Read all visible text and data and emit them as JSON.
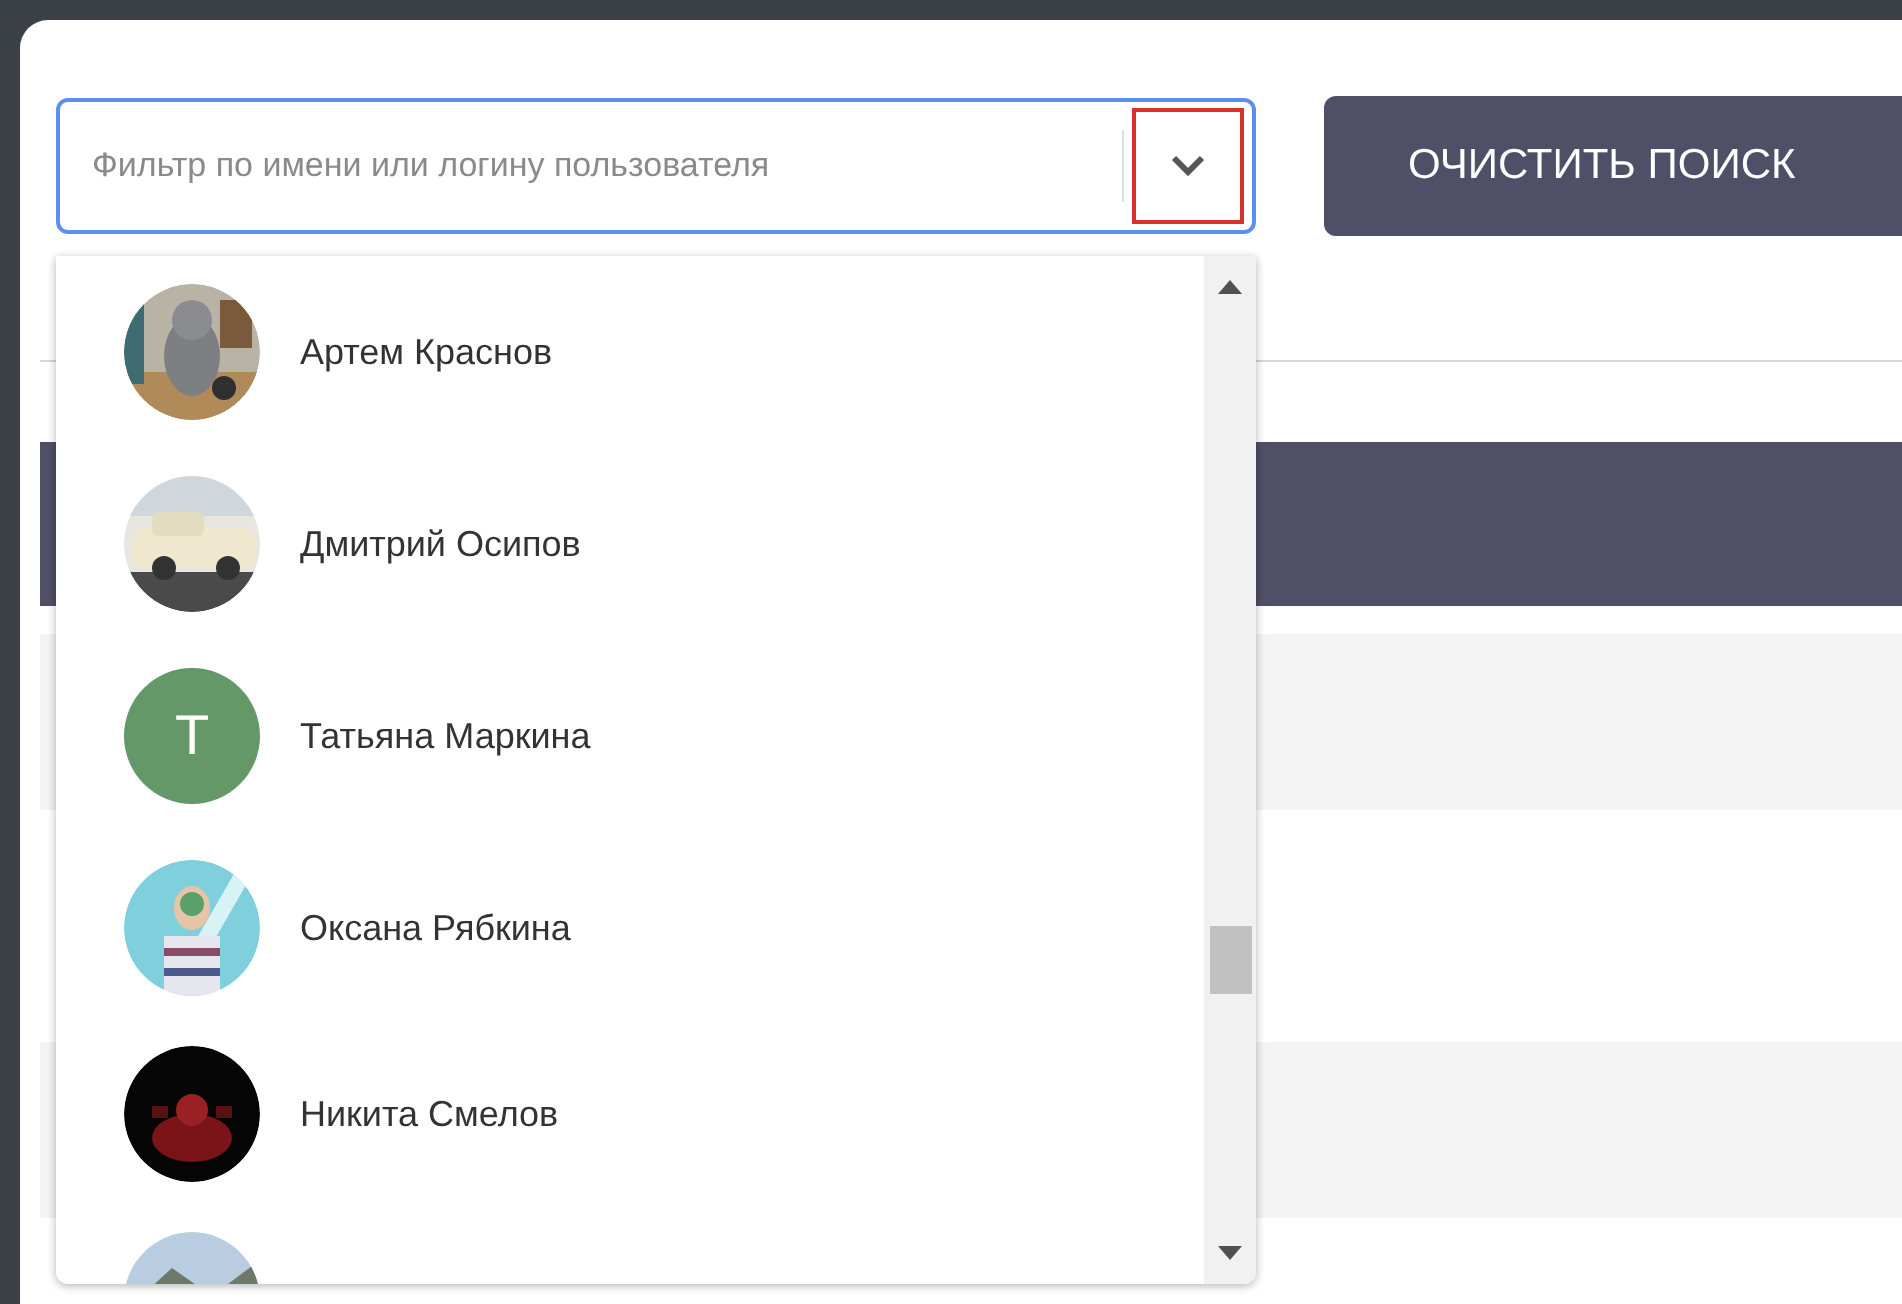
{
  "search": {
    "placeholder": "Фильтр по имени или логину пользователя"
  },
  "clear_button": "ОЧИСТИТЬ ПОИСК",
  "dropdown": {
    "items": [
      {
        "name": "Артем Краснов",
        "avatar": {
          "kind": "picture"
        }
      },
      {
        "name": "Дмитрий Осипов",
        "avatar": {
          "kind": "picture"
        }
      },
      {
        "name": "Татьяна Маркина",
        "avatar": {
          "kind": "letter",
          "letter": "T",
          "color": "#659868"
        }
      },
      {
        "name": "Оксана Рябкина",
        "avatar": {
          "kind": "picture"
        }
      },
      {
        "name": "Никита Смелов",
        "avatar": {
          "kind": "picture"
        }
      },
      {
        "avatar": {
          "kind": "picture"
        }
      }
    ]
  }
}
